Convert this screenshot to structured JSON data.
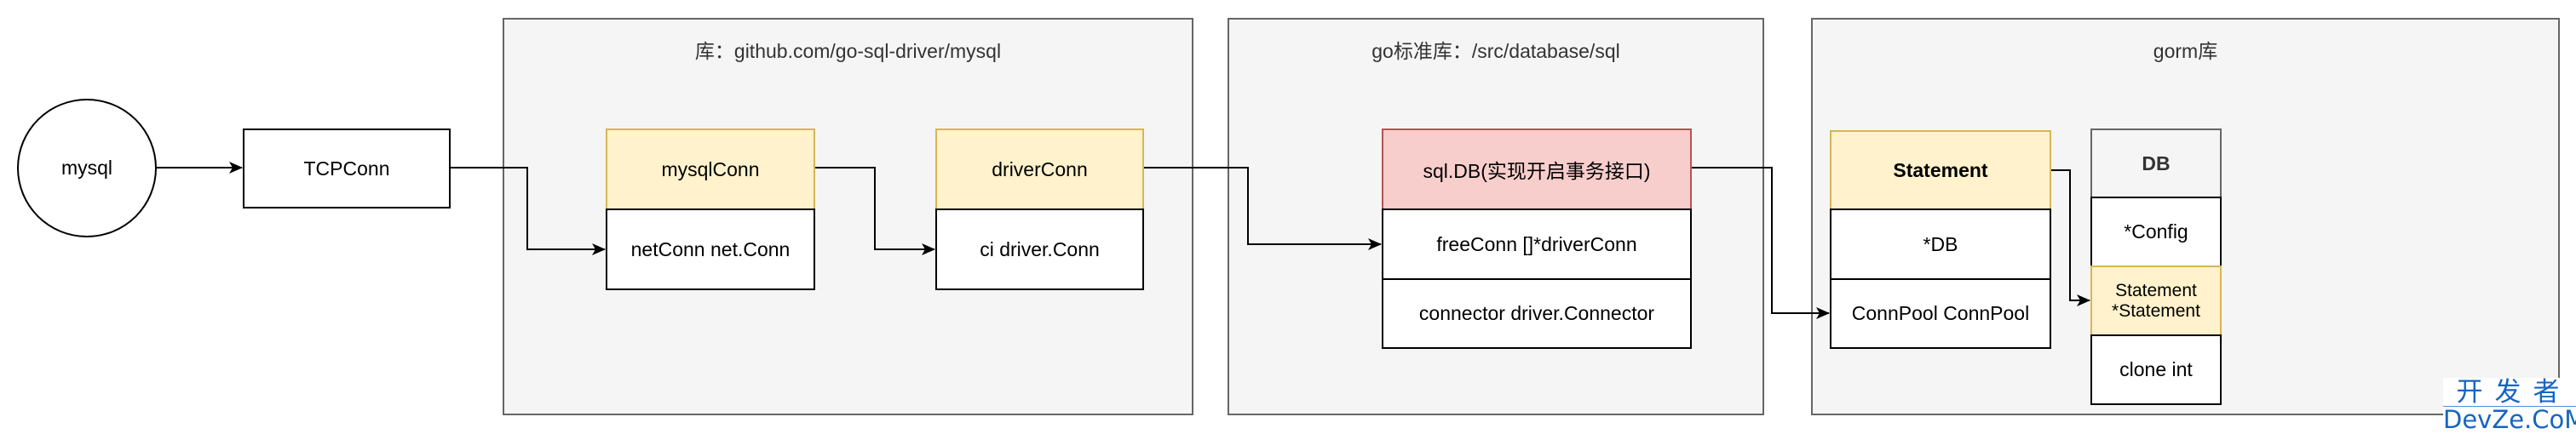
{
  "diagram": {
    "source_node": {
      "label": "mysql",
      "shape": "circle"
    },
    "tcp_node": {
      "label": "TCPConn"
    },
    "containers": [
      {
        "title": "库：github.com/go-sql-driver/mysql",
        "classes": [
          {
            "header": "mysqlConn",
            "header_color": "#fff2cc",
            "fields": [
              "netConn net.Conn"
            ]
          },
          {
            "header": "driverConn",
            "header_color": "#fff2cc",
            "fields": [
              "ci driver.Conn"
            ]
          }
        ]
      },
      {
        "title": "go标准库：/src/database/sql",
        "classes": [
          {
            "header": "sql.DB(实现开启事务接口)",
            "header_color": "#f8cecc",
            "fields": [
              "freeConn []*driverConn",
              "connector driver.Connector"
            ]
          }
        ]
      },
      {
        "title": "gorm库",
        "classes": [
          {
            "header": "Statement",
            "header_color": "#fff2cc",
            "fields": [
              "*DB",
              "ConnPool ConnPool"
            ]
          },
          {
            "header": "DB",
            "header_color": "#f5f5f5",
            "fields": [
              "*Config",
              "Statement *Statement",
              "clone int"
            ],
            "highlighted_field": "Statement *Statement"
          }
        ]
      }
    ],
    "edges": [
      {
        "from": "mysql",
        "to": "TCPConn"
      },
      {
        "from": "TCPConn",
        "to": "mysqlConn.netConn net.Conn"
      },
      {
        "from": "mysqlConn",
        "to": "driverConn.ci driver.Conn"
      },
      {
        "from": "driverConn",
        "to": "sql.DB.freeConn []*driverConn"
      },
      {
        "from": "sql.DB",
        "to": "Statement.ConnPool ConnPool"
      },
      {
        "from": "Statement",
        "to": "DB.Statement *Statement"
      }
    ],
    "colors": {
      "yellow_fill": "#fff2cc",
      "yellow_stroke": "#d6b656",
      "red_fill": "#f8cecc",
      "red_stroke": "#b85450",
      "container_fill": "#f5f5f5",
      "container_stroke": "#666666"
    }
  },
  "watermark": {
    "top": "开发者",
    "bottom": "DevZe.CoM"
  }
}
